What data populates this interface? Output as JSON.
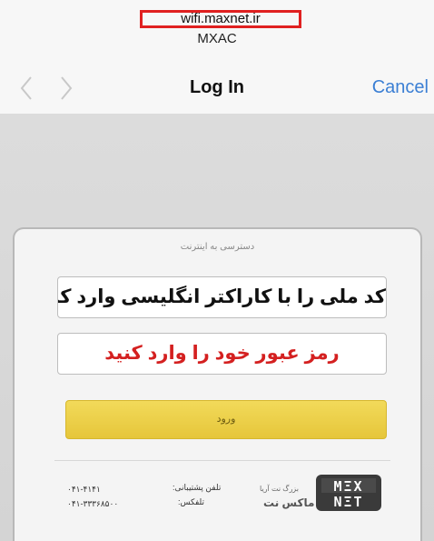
{
  "browser": {
    "url": "wifi.maxnet.ir",
    "network_name": "MXAC"
  },
  "nav": {
    "title": "Log In",
    "cancel_label": "Cancel",
    "back_icon": "chevron-left-icon",
    "forward_icon": "chevron-right-icon"
  },
  "login_card": {
    "title": "دسترسی به اینترنت",
    "national_code_field": "کد ملی را با کاراکتر انگلیسی وارد کنید",
    "password_field": "رمز عبور خود را وارد کنید",
    "submit_label": "ورود"
  },
  "footer": {
    "support_label": "تلفن پشتیبانی:",
    "support_number": "۰۴۱-۴۱۴۱",
    "fax_label": "تلفکس:",
    "fax_number": "۰۴۱-۳۳۳۶۸۵۰۰",
    "company_caption": "بزرگ نت آریا",
    "company_name": "ماکس نت",
    "logo_text": "MAX NET"
  },
  "colors": {
    "link_blue": "#3b7fd4",
    "highlight_red": "#e02020",
    "password_red": "#d42020",
    "button_yellow": "#ecd04a"
  }
}
